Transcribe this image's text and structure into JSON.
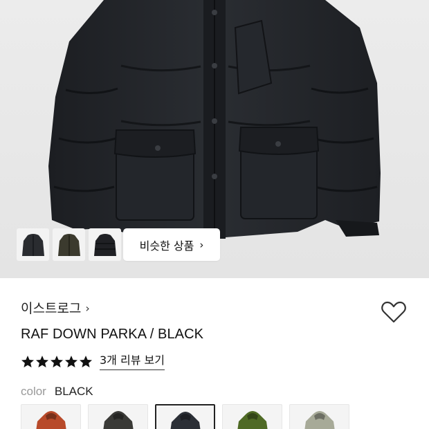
{
  "hero": {
    "similar_button": {
      "label": "비슷한 상품",
      "chevron": "›"
    },
    "thumbnails": [
      {
        "icon": "jacket-black-thumbnail",
        "color": "#2a2c30"
      },
      {
        "icon": "jacket-olive-thumbnail",
        "color": "#3b3a2e"
      },
      {
        "icon": "jacket-black-puffer-thumbnail",
        "color": "#1f2024"
      }
    ]
  },
  "product": {
    "brand": "이스트로그",
    "brand_chevron": "›",
    "title": "RAF DOWN PARKA / BLACK",
    "rating": {
      "stars": 5,
      "max": 5,
      "review_link": "3개 리뷰 보기"
    },
    "color": {
      "label": "color",
      "value": "BLACK"
    },
    "swatches": [
      {
        "name": "orange",
        "color": "#b84a2a",
        "selected": false
      },
      {
        "name": "charcoal",
        "color": "#3a3a37",
        "selected": false
      },
      {
        "name": "black",
        "color": "#2b2f36",
        "selected": true
      },
      {
        "name": "green",
        "color": "#4f6a25",
        "selected": false
      },
      {
        "name": "sage",
        "color": "#a7aa98",
        "selected": false
      }
    ]
  },
  "colors": {
    "accent": "#111111",
    "muted_text": "#999999",
    "hero_bg": "#e9e9e9"
  }
}
